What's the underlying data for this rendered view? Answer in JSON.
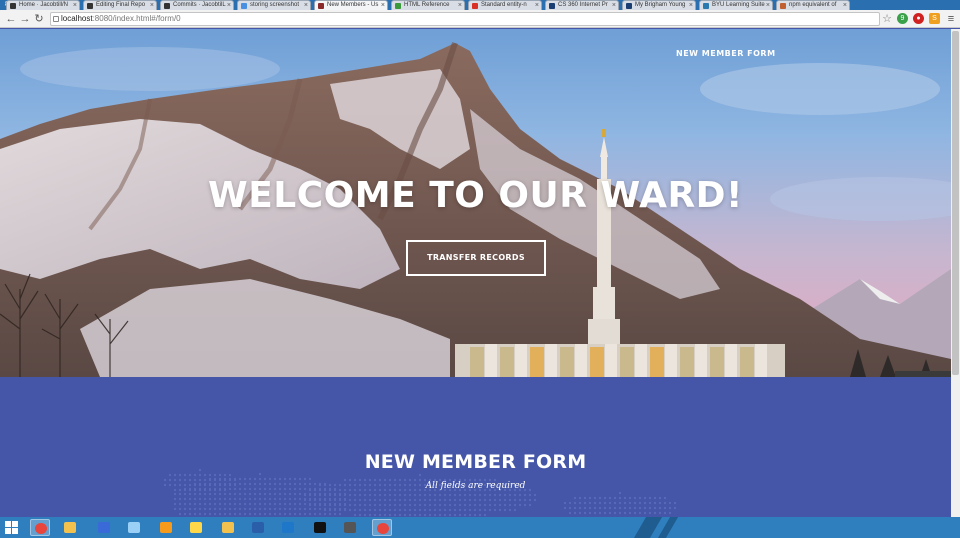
{
  "browser": {
    "tabs": [
      {
        "label": "Home · Jacobtill/N",
        "color": "#333333"
      },
      {
        "label": "Editing Final Repo",
        "color": "#333333"
      },
      {
        "label": "Commits · JacobtilL",
        "color": "#333333"
      },
      {
        "label": "storing screenshot",
        "color": "#4a90e2"
      },
      {
        "label": "New Members - Us",
        "color": "#8b2a2a",
        "active": true
      },
      {
        "label": "HTML Reference",
        "color": "#3a9a3a"
      },
      {
        "label": "Standard entity-n",
        "color": "#d93025"
      },
      {
        "label": "CS 360 Internet Pr",
        "color": "#1a3e72"
      },
      {
        "label": "My Brigham Young",
        "color": "#1a3e72"
      },
      {
        "label": "BYU Learning Suite",
        "color": "#2a7ab0"
      },
      {
        "label": "npm equivalent of",
        "color": "#c06030"
      }
    ],
    "url_host": "localhost",
    "url_path": ":8080/index.html#/form/0"
  },
  "nav": {
    "link_label": "NEW MEMBER FORM"
  },
  "hero": {
    "title": "WELCOME TO OUR WARD!",
    "button_label": "TRANSFER RECORDS"
  },
  "form": {
    "title": "NEW MEMBER FORM",
    "subtitle": "All fields are required"
  },
  "taskbar": {
    "apps": [
      {
        "name": "chrome",
        "color": "#e8453c"
      },
      {
        "name": "file-explorer",
        "color": "#f2c14e"
      },
      {
        "name": "media",
        "color": "#3a6ad8"
      },
      {
        "name": "cube",
        "color": "#9ad0f5"
      },
      {
        "name": "flame",
        "color": "#f59a1a"
      },
      {
        "name": "star",
        "color": "#ffd84a"
      },
      {
        "name": "paint",
        "color": "#f2c14e"
      },
      {
        "name": "powershell",
        "color": "#2b5ea8"
      },
      {
        "name": "lync",
        "color": "#1e77c8"
      },
      {
        "name": "terminal",
        "color": "#111111"
      },
      {
        "name": "sublime",
        "color": "#555555"
      },
      {
        "name": "chrome-2",
        "color": "#e8453c"
      }
    ]
  },
  "colors": {
    "section_bg": "#4556a8",
    "taskbar": "#2f7fbf"
  }
}
